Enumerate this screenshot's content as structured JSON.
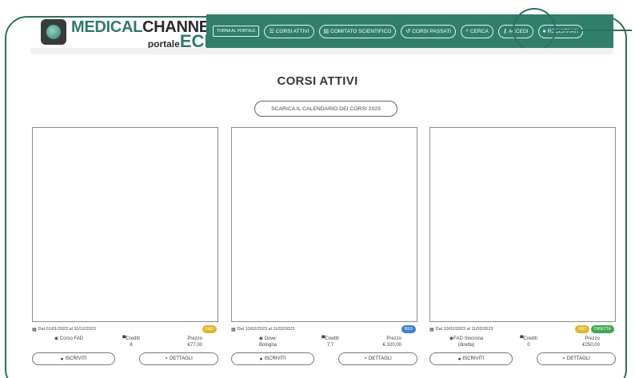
{
  "brand": {
    "line1a": "MEDICAL",
    "line1b": "CHANNEL",
    "line2a": "portale",
    "line2b": "ECM"
  },
  "nav": [
    {
      "label": "TORNA AL PORTALE",
      "icon": ""
    },
    {
      "label": "CORSI ATTIVI",
      "icon": "list-icon"
    },
    {
      "label": "COMITATO SCIENTIFICO",
      "icon": "book-icon"
    },
    {
      "label": "CORSI PASSATI",
      "icon": "history-icon"
    },
    {
      "label": "CERCA",
      "icon": "search-icon"
    },
    {
      "label": "ACCEDI",
      "icon": "key-icon"
    },
    {
      "label": "REGISTRATI",
      "icon": "user-icon"
    }
  ],
  "page": {
    "title": "CORSI ATTIVI",
    "download_label": "SCARICA IL CALENDARIO DEI CORSI 2023"
  },
  "cards": [
    {
      "date": "Dal 01/01/2023 al 31/12/2023",
      "badges": [
        "FAD"
      ],
      "col1_label": "Corso FAD",
      "col1_value": "",
      "credits_label": "Crediti",
      "credits_value": "8",
      "price_label": "Prezzo",
      "price_value": "€77,00",
      "enroll_label": "ISCRIVITI",
      "details_label": "DETTAGLI"
    },
    {
      "date": "Dal 10/02/2023 al 11/02/2023",
      "badges": [
        "RES"
      ],
      "col1_label": "Dove:",
      "col1_value": "Bologna",
      "credits_label": "Crediti",
      "credits_value": "7,7",
      "price_label": "Prezzo",
      "price_value": "€ 320,00",
      "enroll_label": "ISCRIVITI",
      "details_label": "DETTAGLI"
    },
    {
      "date": "Dal 10/02/2023 al 11/02/2023",
      "badges": [
        "FAD",
        "DIRETTA"
      ],
      "col1_label": "FAD Sincrona",
      "col1_value": "(diretta)",
      "credits_label": "Crediti",
      "credits_value": "0",
      "price_label": "Prezzo",
      "price_value": "€250,00",
      "enroll_label": "ISCRIVITI",
      "details_label": "DETTAGLI"
    }
  ],
  "colors": {
    "brand_green": "#2f7f6c",
    "frame": "#2e6f63",
    "badge_fad": "#e2b52a",
    "badge_res": "#3c7fd0",
    "badge_diretta": "#3daa4c"
  }
}
